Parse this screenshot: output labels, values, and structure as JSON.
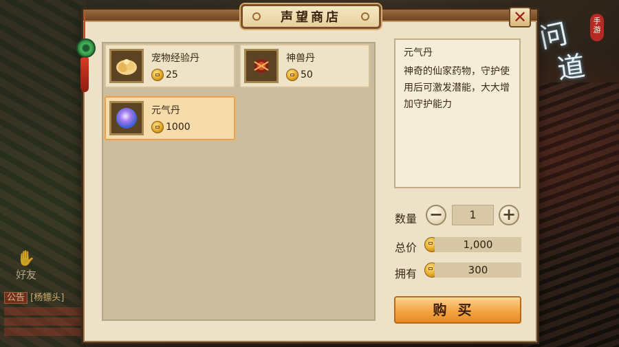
{
  "window": {
    "title": "声望商店",
    "close_label": "✕"
  },
  "logo": {
    "badge": "手游",
    "chars": [
      "问",
      "道"
    ]
  },
  "background": {
    "friend_label": "好友",
    "chat_tag": "公告",
    "chat_text": "[杨镖头]"
  },
  "items": [
    {
      "name": "宠物经验丹",
      "price": "25",
      "icon": "gourd-pill-icon",
      "selected": false
    },
    {
      "name": "神兽丹",
      "price": "50",
      "icon": "beast-pill-icon",
      "selected": false
    },
    {
      "name": "元气丹",
      "price": "1000",
      "icon": "spirit-orb-icon",
      "selected": true
    }
  ],
  "detail": {
    "name": "元气丹",
    "description": "神奇的仙家药物，守护使用后可激发潜能，大大增加守护能力"
  },
  "purchase": {
    "quantity_label": "数量",
    "quantity_value": "1",
    "minus_label": "−",
    "plus_label": "+",
    "total_label": "总价",
    "total_value": "1,000",
    "owned_label": "拥有",
    "owned_value": "300",
    "buy_label": "购买"
  },
  "colors": {
    "accent": "#f3a546",
    "panel": "#ede2c7",
    "selected_border": "#e2a15b"
  }
}
